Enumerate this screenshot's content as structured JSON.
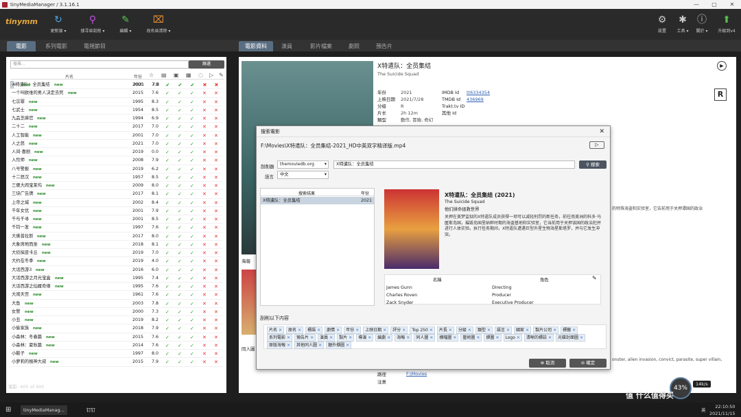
{
  "app": {
    "title": "tinyMediaManager / 3.1.16.1"
  },
  "toolbar": {
    "logo": "tinymm",
    "update": "更新源 ▾",
    "search": "搜寻並刮削 ▾",
    "edit": "編輯 ▾",
    "rename": "改名並清除 ▾",
    "settings": "設置",
    "tools": "工具 ▾",
    "about": "關於 ▾",
    "upgrade": "升級到v4"
  },
  "left_tabs": [
    "電影",
    "系列電影",
    "電視節目"
  ],
  "right_tabs": [
    "電影資料",
    "演員",
    "影片檔案",
    "劇照",
    "預告片"
  ],
  "left": {
    "search_placeholder": "搜尋...",
    "filter_label": "篩選",
    "col_title": "片名",
    "col_year": "年份",
    "status": "電影:  405  of  405"
  },
  "movies": [
    {
      "t": "X特遣队：全员集结",
      "n": "new",
      "y": "2021",
      "r": "7.8"
    },
    {
      "t": "----",
      "n": "new",
      "y": "2000",
      "r": "7.9"
    },
    {
      "t": "一个叫欧维的男人决定去死",
      "n": "new",
      "y": "2015",
      "r": "7.6"
    },
    {
      "t": "七宗罪",
      "n": "new",
      "y": "1995",
      "r": "8.3"
    },
    {
      "t": "七武士",
      "n": "new",
      "y": "1954",
      "r": "8.5"
    },
    {
      "t": "九品芝麻官",
      "n": "new",
      "y": "1994",
      "r": "6.9"
    },
    {
      "t": "二十二",
      "n": "new",
      "y": "2017",
      "r": "7.0"
    },
    {
      "t": "人工智能",
      "n": "new",
      "y": "2001",
      "r": "7.0"
    },
    {
      "t": "人之怒",
      "n": "new",
      "y": "2021",
      "r": "7.0"
    },
    {
      "t": "人间·喜剧",
      "n": "new",
      "y": "2019",
      "r": "0.0"
    },
    {
      "t": "入殓师",
      "n": "new",
      "y": "2008",
      "r": "7.9"
    },
    {
      "t": "八号警报",
      "n": "new",
      "y": "2019",
      "r": "6.2"
    },
    {
      "t": "十二怒汉",
      "n": "new",
      "y": "1957",
      "r": "8.5"
    },
    {
      "t": "三傻大闹宝莱坞",
      "n": "new",
      "y": "2009",
      "r": "8.0"
    },
    {
      "t": "三块广告牌",
      "n": "new",
      "y": "2017",
      "r": "8.1"
    },
    {
      "t": "上帝之城",
      "n": "new",
      "y": "2002",
      "r": "8.4"
    },
    {
      "t": "千年女优",
      "n": "new",
      "y": "2001",
      "r": "7.9"
    },
    {
      "t": "千与千寻",
      "n": "new",
      "y": "2001",
      "r": "8.5"
    },
    {
      "t": "千钧一发",
      "n": "new",
      "y": "1997",
      "r": "7.6"
    },
    {
      "t": "大佛普拉斯",
      "n": "new",
      "y": "2017",
      "r": "8.0"
    },
    {
      "t": "大象席地而坐",
      "n": "new",
      "y": "2018",
      "r": "8.1"
    },
    {
      "t": "大侦探皮卡丘",
      "n": "new",
      "y": "2019",
      "r": "7.0"
    },
    {
      "t": "大约在冬季",
      "n": "new",
      "y": "2019",
      "r": "4.0"
    },
    {
      "t": "大话西游3",
      "n": "new",
      "y": "2016",
      "r": "6.0"
    },
    {
      "t": "大话西游之月光宝盒",
      "n": "new",
      "y": "1995",
      "r": "7.4"
    },
    {
      "t": "大话西游之仙履奇缘",
      "n": "new",
      "y": "1995",
      "r": "7.6"
    },
    {
      "t": "大闹天宫",
      "n": "new",
      "y": "1961",
      "r": "7.6"
    },
    {
      "t": "大鱼",
      "n": "new",
      "y": "2003",
      "r": "7.8"
    },
    {
      "t": "女警",
      "n": "new",
      "y": "2000",
      "r": "7.3"
    },
    {
      "t": "小丑",
      "n": "new",
      "y": "2019",
      "r": "8.2"
    },
    {
      "t": "小偷家族",
      "n": "new",
      "y": "2018",
      "r": "7.9"
    },
    {
      "t": "小森林：冬春篇",
      "n": "new",
      "y": "2015",
      "r": "7.6"
    },
    {
      "t": "小森林：夏秋篇",
      "n": "new",
      "y": "2014",
      "r": "7.6"
    },
    {
      "t": "小鞋子",
      "n": "new",
      "y": "1997",
      "r": "8.0"
    },
    {
      "t": "小萝莉的猴神大叔",
      "n": "new",
      "y": "2015",
      "r": "7.9"
    }
  ],
  "detail": {
    "title": "X特遣队：全员集结",
    "subtitle": "The Suicide Squad",
    "year_l": "年份",
    "year": "2021",
    "imdb_l": "IMDB Id",
    "imdb": "tt6334354",
    "rel_l": "上映日期",
    "rel": "2021/7/28",
    "tmdb_l": "TMDB Id",
    "tmdb": "436969",
    "cert_l": "分级",
    "cert": "R",
    "trakt": "Trakt.tv ID",
    "len_l": "片长",
    "len": "2h 12m",
    "other": "其他 Id",
    "genre_l": "類型",
    "genre": "動作, 冒險, 奇幻",
    "poster_l": "海報",
    "fanart_l": "同人圖",
    "path_l": "路徑",
    "path": "F:\\Movies",
    "note_l": "注意",
    "overflow1": "的特殊海盗和实验室，它告前用于关押谭国的政治",
    "overflow2": "onster, alien invasion, convict, parasite, super villain,",
    "rating_badge": "R"
  },
  "dialog": {
    "title": "搜索電影",
    "file": "F:\\Movies\\X特遣队：全员集结-2021_HD中英双字精译版.mp4",
    "scraper_l": "刮削器",
    "scraper": "themoviedb.org",
    "query": "X特遣队：全员集结",
    "search_btn": "搜索",
    "lang_l": "語言",
    "lang": "中文",
    "res_h": "搜索结果",
    "res_y": "年份",
    "results": [
      {
        "t": "X特遣队：全员集结",
        "y": "2021"
      }
    ],
    "m_title": "X特遣队：全员集结 (2021)",
    "m_orig": "The Suicide Squad",
    "m_tag": "他们拼命拯救世界",
    "m_plot": "关押在美梦监狱的X特遣队成员获得一项可以减轻刑罚的新任务，前往南美洲的科多·马匿斯岛国，摧毁岛国里纳粹时期的海盗基地和实验室，它当前用于关押该国的政治犯并进行人体实验。执行任务期间，X特遣队遭遇巨型外星生物海星斯塔罗，并与它发生冲突。",
    "crew_name": "名稱",
    "crew_role": "角色",
    "crew": [
      {
        "n": "James Gunn",
        "r": "Directing"
      },
      {
        "n": "Charles Roven",
        "r": "Producer"
      },
      {
        "n": "Zack Snyder",
        "r": "Executive Producer"
      }
    ],
    "scrape_l": "刮削以下内容",
    "tags": [
      "片名",
      "原名",
      "標語",
      "劇情",
      "年份",
      "上映日期",
      "評分",
      "Top 250",
      "片長",
      "分級",
      "類型",
      "語言",
      "國家",
      "製片公司",
      "標籤",
      "系列電影",
      "預告片",
      "演員",
      "製片",
      "導演",
      "編劇",
      "海報",
      "同人圖",
      "橫幅圖",
      "藝術圖",
      "擷圖",
      "Logo",
      "清晰的標誌",
      "光碟封面圖",
      "原版海報",
      "其他同人圖",
      "額外擷圖"
    ],
    "cancel": "取消",
    "ok": "確定"
  },
  "taskbar": {
    "app1": "tinyMediaManag...",
    "app2": "钉钉",
    "time": "22:10:50",
    "date": "2021/11/15",
    "ime": "英",
    "watermark": "值 什么值得买"
  },
  "widget": {
    "pct": "43%",
    "speed": "14k/s"
  }
}
